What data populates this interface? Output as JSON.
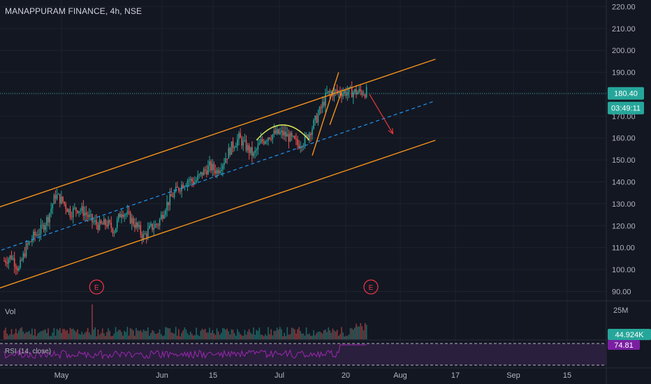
{
  "header": {
    "title": "MANAPPURAM FINANCE, 4h, NSE"
  },
  "colors": {
    "background": "#131722",
    "grid": "#1e222d",
    "bull": "#26a69a",
    "bear": "#ef5350",
    "channel": "#f7931a",
    "midline": "#2196f3",
    "arc": "#d4e157",
    "arrow": "#e53935",
    "price_label": "#26a69a",
    "rsi_line": "#9c27b0",
    "rsi_bg": "#2a1f3d",
    "earnings": "#f23645"
  },
  "chart_data": {
    "type": "candlestick",
    "symbol": "MANAPPURAM FINANCE",
    "interval": "4h",
    "exchange": "NSE",
    "y_ticks": [
      "220.00",
      "210.00",
      "200.00",
      "190.00",
      "180.00",
      "170.00",
      "160.00",
      "150.00",
      "140.00",
      "130.00",
      "120.00",
      "110.00",
      "100.00",
      "90.00"
    ],
    "ylim": [
      86,
      223
    ],
    "x_ticks": [
      "May",
      "Jun",
      "15",
      "Jul",
      "20",
      "Aug",
      "17",
      "Sep",
      "15"
    ],
    "last_price": "180.40",
    "countdown": "03:49:11",
    "price_path": [
      [
        0,
        104
      ],
      [
        5,
        106
      ],
      [
        10,
        100
      ],
      [
        15,
        110
      ],
      [
        20,
        115
      ],
      [
        25,
        118
      ],
      [
        30,
        124
      ],
      [
        35,
        134
      ],
      [
        40,
        131
      ],
      [
        45,
        126
      ],
      [
        50,
        128
      ],
      [
        55,
        126
      ],
      [
        60,
        122
      ],
      [
        65,
        120
      ],
      [
        70,
        121
      ],
      [
        75,
        118
      ],
      [
        80,
        127
      ],
      [
        85,
        124
      ],
      [
        90,
        120
      ],
      [
        95,
        115
      ],
      [
        100,
        119
      ],
      [
        105,
        121
      ],
      [
        110,
        129
      ],
      [
        115,
        134
      ],
      [
        120,
        138
      ],
      [
        125,
        141
      ],
      [
        130,
        140
      ],
      [
        135,
        144
      ],
      [
        140,
        147
      ],
      [
        145,
        145
      ],
      [
        150,
        150
      ],
      [
        155,
        156
      ],
      [
        160,
        160
      ],
      [
        165,
        156
      ],
      [
        170,
        152
      ],
      [
        175,
        158
      ],
      [
        180,
        161
      ],
      [
        185,
        162
      ],
      [
        190,
        162
      ],
      [
        195,
        160
      ],
      [
        200,
        157
      ],
      [
        205,
        159
      ],
      [
        210,
        165
      ],
      [
        215,
        172
      ],
      [
        220,
        180
      ],
      [
        225,
        181
      ]
    ],
    "channel_upper": [
      [
        -10,
        127
      ],
      [
        294,
        196
      ]
    ],
    "channel_lower": [
      [
        -10,
        90
      ],
      [
        294,
        159
      ]
    ],
    "channel_mid": [
      [
        -10,
        107
      ],
      [
        294,
        177
      ]
    ],
    "wedge_left": [
      [
        210,
        152
      ],
      [
        228,
        190
      ]
    ],
    "wedge_right": [
      [
        222,
        166
      ],
      [
        230,
        181
      ]
    ],
    "arc": {
      "x0": 172,
      "x1": 208,
      "base": 159,
      "peak": 166
    },
    "arrow": {
      "from": [
        249,
        180
      ],
      "to": [
        265,
        162
      ]
    },
    "earnings_markers": [
      {
        "x": 63,
        "label": "E"
      },
      {
        "x": 250,
        "label": "E"
      }
    ],
    "volume": {
      "label": "Vol",
      "scale_label": "25M",
      "last": "44.924K",
      "spike_x": 60
    },
    "rsi": {
      "label": "RSI (14, close)",
      "last": "74.81",
      "upper_band": 70,
      "lower_band": 30
    }
  }
}
